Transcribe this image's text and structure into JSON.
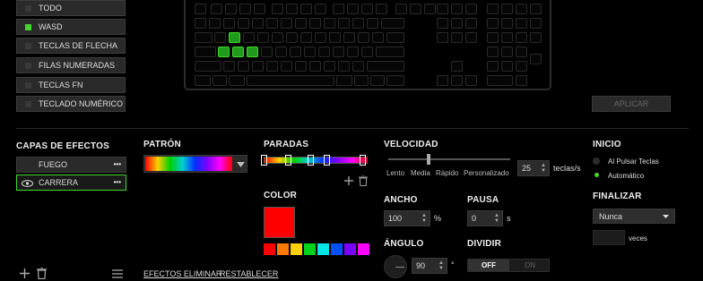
{
  "zones": [
    {
      "label": "TODO",
      "active": false
    },
    {
      "label": "WASD",
      "active": true
    },
    {
      "label": "TECLAS DE FLECHA",
      "active": false
    },
    {
      "label": "FILAS NUMERADAS",
      "active": false
    },
    {
      "label": "TECLAS FN",
      "active": false
    },
    {
      "label": "TECLADO NUMÉRICO",
      "active": false
    }
  ],
  "apply_label": "APLICAR",
  "layers": {
    "title": "CAPAS DE EFECTOS",
    "items": [
      {
        "label": "FUEGO"
      },
      {
        "label": "CARRERA"
      }
    ],
    "more_glyph": "•••",
    "delete_effects": "EFECTOS ELIMINAR",
    "reset": "RESTABLECER"
  },
  "pattern": {
    "title": "PATRÓN"
  },
  "stops": {
    "title": "PARADAS"
  },
  "color": {
    "title": "COLOR",
    "selected": "#ff0000",
    "palette": [
      "#ff0000",
      "#ff7a00",
      "#ffd000",
      "#00d21c",
      "#00e6e6",
      "#0050ff",
      "#7a00ff",
      "#ff00ff"
    ]
  },
  "speed": {
    "title": "VELOCIDAD",
    "marks": [
      "Lento",
      "Media",
      "Rápido",
      "Personalizado"
    ],
    "value": "25",
    "unit": "teclas/s"
  },
  "width": {
    "title": "ANCHO",
    "value": "100",
    "unit": "%"
  },
  "pause": {
    "title": "PAUSA",
    "value": "0",
    "unit": "s"
  },
  "angle": {
    "title": "ÁNGULO",
    "value": "90",
    "unit": "°"
  },
  "divide": {
    "title": "DIVIDIR",
    "off": "OFF",
    "on": "ON"
  },
  "start": {
    "title": "INICIO",
    "options": [
      "Al Pulsar Teclas",
      "Automático"
    ],
    "selected": 1
  },
  "finish": {
    "title": "FINALIZAR",
    "dropdown": "Nunca",
    "times_label": "veces"
  }
}
